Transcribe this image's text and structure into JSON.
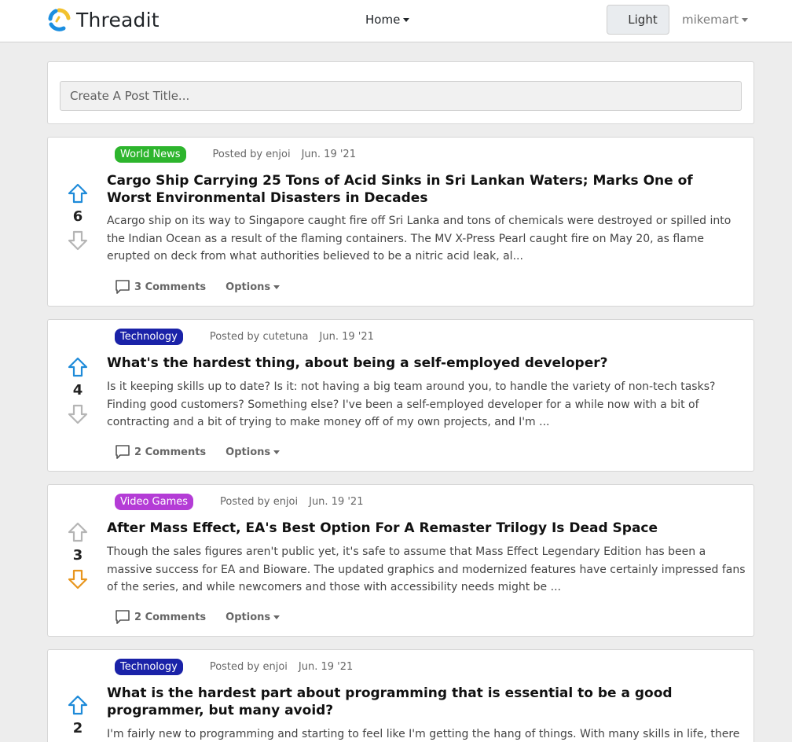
{
  "nav": {
    "brand": "Threadit",
    "home": "Home",
    "theme_toggle": "Light",
    "username": "mikemart"
  },
  "create_post": {
    "placeholder": "Create A Post Title..."
  },
  "posts": [
    {
      "category": "World News",
      "category_color": "#2db52d",
      "posted_by": "Posted by enjoi",
      "date": "Jun. 19 '21",
      "score": "6",
      "vote_state": "up",
      "title": "Cargo Ship Carrying 25 Tons of Acid Sinks in Sri Lankan Waters; Marks One of Worst Environmental Disasters in Decades",
      "excerpt": "Acargo ship on its way to Singapore caught fire off Sri Lanka and tons of chemicals were destroyed or spilled into the Indian Ocean as a result of the flaming containers. The MV X-Press Pearl caught fire on May 20, as flame erupted on deck from what authorities believed to be a nitric acid leak, al...",
      "comments": "3 Comments",
      "options": "Options"
    },
    {
      "category": "Technology",
      "category_color": "#1a22a8",
      "posted_by": "Posted by cutetuna",
      "date": "Jun. 19 '21",
      "score": "4",
      "vote_state": "up",
      "title": "What's the hardest thing, about being a self-employed developer?",
      "excerpt": "Is it keeping skills up to date? Is it: not having a big team around you, to handle the variety of non-tech tasks? Finding good customers? Something else? I've been a self-employed developer for a while now with a bit of contracting and a bit of trying to make money off of my own projects, and I'm ...",
      "comments": "2 Comments",
      "options": "Options"
    },
    {
      "category": "Video Games",
      "category_color": "#b43cd6",
      "posted_by": "Posted by enjoi",
      "date": "Jun. 19 '21",
      "score": "3",
      "vote_state": "down",
      "title": "After Mass Effect, EA's Best Option For A Remaster Trilogy Is Dead Space",
      "excerpt": "Though the sales figures aren't public yet, it's safe to assume that Mass Effect Legendary Edition has been a massive success for EA and Bioware. The updated graphics and modernized features have certainly impressed fans of the series, and while newcomers and those with accessibility needs might be ...",
      "comments": "2 Comments",
      "options": "Options"
    },
    {
      "category": "Technology",
      "category_color": "#1a22a8",
      "posted_by": "Posted by enjoi",
      "date": "Jun. 19 '21",
      "score": "2",
      "vote_state": "up",
      "title": "What is the hardest part about programming that is essential to be a good programmer, but many avoid?",
      "excerpt": "I'm fairly new to programming and starting to feel like I'm getting the hang of things. With many skills in life, there",
      "comments": "",
      "options": ""
    }
  ],
  "colors": {
    "upvote_active": "#1f8bd9",
    "downvote_active": "#e8961e",
    "vote_inactive": "#b5b5b5"
  }
}
